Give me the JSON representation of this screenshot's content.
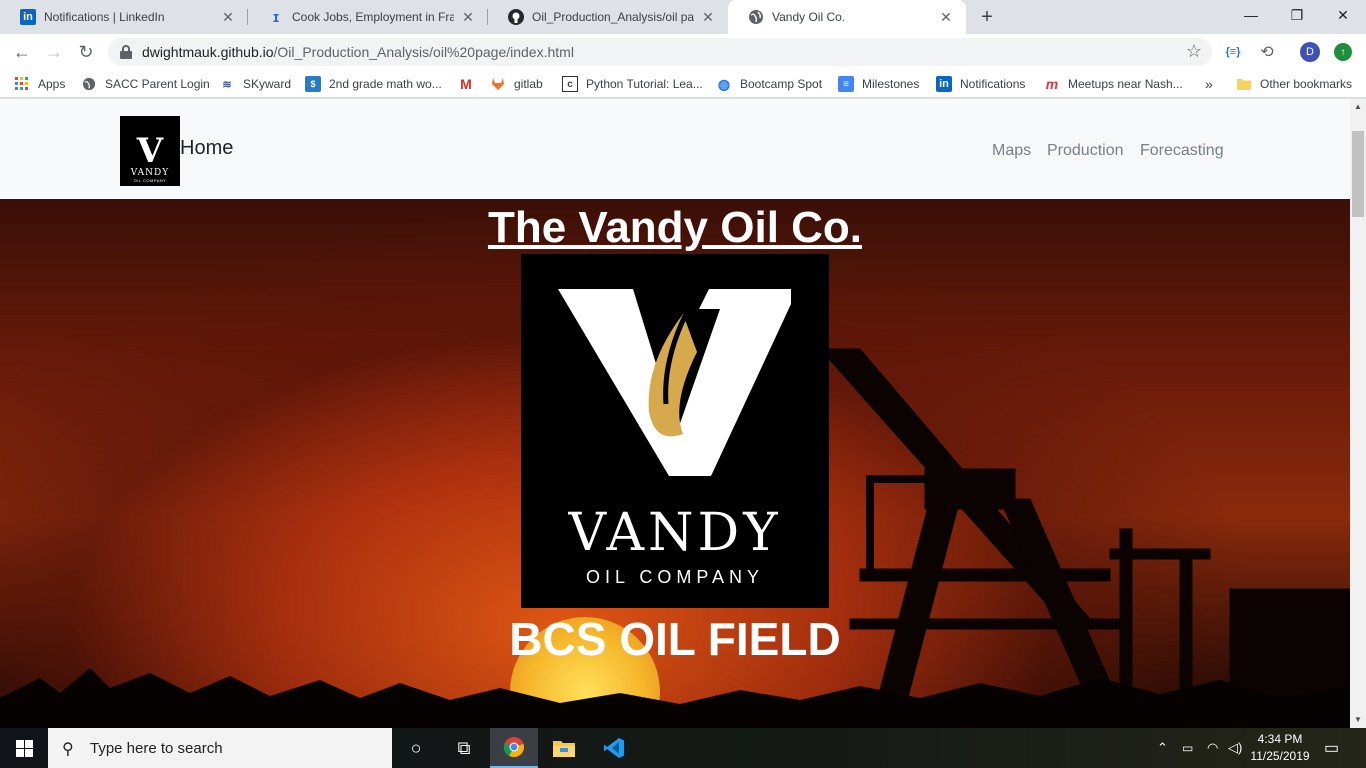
{
  "browser": {
    "tabs": [
      {
        "title": "Notifications | LinkedIn",
        "icon": "linkedin-icon"
      },
      {
        "title": "Cook Jobs, Employment in Frankl",
        "icon": "indeed-icon"
      },
      {
        "title": "Oil_Production_Analysis/oil page",
        "icon": "github-icon"
      },
      {
        "title": "Vandy Oil Co.",
        "icon": "globe-icon"
      }
    ],
    "url_host": "dwightmauk.github.io",
    "url_path": "/Oil_Production_Analysis/oil%20page/index.html",
    "profile_initial": "D",
    "bookmarks": [
      {
        "label": "Apps",
        "icon": "apps-grid-icon"
      },
      {
        "label": "SACC Parent Login",
        "icon": "globe-icon"
      },
      {
        "label": "SKyward",
        "icon": "skyward-icon"
      },
      {
        "label": "2nd grade math wo...",
        "icon": "math-icon"
      },
      {
        "label": "",
        "icon": "gmail-icon"
      },
      {
        "label": "gitlab",
        "icon": "gitlab-icon"
      },
      {
        "label": "Python Tutorial: Lea...",
        "icon": "python-tutorial-icon"
      },
      {
        "label": "Bootcamp Spot",
        "icon": "bootcamp-icon"
      },
      {
        "label": "Milestones",
        "icon": "milestones-icon"
      },
      {
        "label": "Notifications",
        "icon": "linkedin-icon"
      },
      {
        "label": "Meetups near Nash...",
        "icon": "meetup-icon"
      }
    ],
    "more_bookmarks": "»",
    "other_bookmarks": "Other bookmarks"
  },
  "site": {
    "nav_logo_letter": "V",
    "nav_logo_word": "VANDY",
    "nav_logo_sub": "OIL COMPANY",
    "nav_home": "Home",
    "nav_links": [
      "Maps",
      "Production",
      "Forecasting"
    ],
    "hero_title": "The Vandy Oil Co.",
    "hero_logo_brand": "VANDY",
    "hero_logo_sub": "OIL COMPANY",
    "field_name": "BCS OIL FIELD"
  },
  "taskbar": {
    "search_placeholder": "Type here to search",
    "time": "4:34 PM",
    "date": "11/25/2019"
  },
  "colors": {
    "navbar_bg": "#f8f9fa",
    "accent_blue": "#1a73e8",
    "logo_gold": "#d6a94c"
  }
}
